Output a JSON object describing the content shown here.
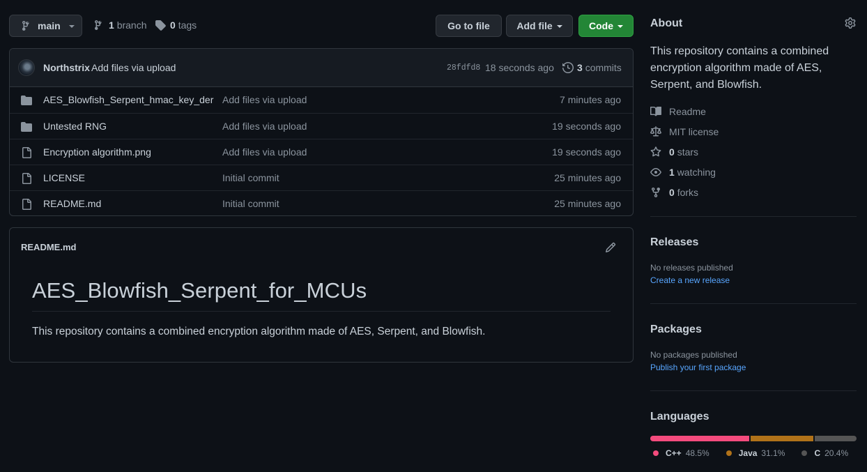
{
  "toolbar": {
    "branch_name": "main",
    "branch_count": "1",
    "branch_label": "branch",
    "tag_count": "0",
    "tag_label": "tags",
    "goto_file_label": "Go to file",
    "add_file_label": "Add file",
    "code_label": "Code"
  },
  "commit": {
    "author": "Northstrix",
    "message": "Add files via upload",
    "sha": "28fdfd8",
    "time": "18 seconds ago",
    "commits_count": "3",
    "commits_label": "commits"
  },
  "files": [
    {
      "type": "folder",
      "name": "AES_Blowfish_Serpent_hmac_key_der",
      "commit": "Add files via upload",
      "age": "7 minutes ago"
    },
    {
      "type": "folder",
      "name": "Untested RNG",
      "commit": "Add files via upload",
      "age": "19 seconds ago"
    },
    {
      "type": "file",
      "name": "Encryption algorithm.png",
      "commit": "Add files via upload",
      "age": "19 seconds ago"
    },
    {
      "type": "file",
      "name": "LICENSE",
      "commit": "Initial commit",
      "age": "25 minutes ago"
    },
    {
      "type": "file",
      "name": "README.md",
      "commit": "Initial commit",
      "age": "25 minutes ago"
    }
  ],
  "readme": {
    "filename": "README.md",
    "heading": "AES_Blowfish_Serpent_for_MCUs",
    "paragraph": "This repository contains a combined encryption algorithm made of AES, Serpent, and Blowfish."
  },
  "about": {
    "title": "About",
    "description": "This repository contains a combined encryption algorithm made of AES, Serpent, and Blowfish.",
    "readme_label": "Readme",
    "license_label": "MIT license",
    "stars_count": "0",
    "stars_label": "stars",
    "watching_count": "1",
    "watching_label": "watching",
    "forks_count": "0",
    "forks_label": "forks"
  },
  "releases": {
    "title": "Releases",
    "empty_text": "No releases published",
    "create_link": "Create a new release"
  },
  "packages": {
    "title": "Packages",
    "empty_text": "No packages published",
    "publish_link": "Publish your first package"
  },
  "languages": {
    "title": "Languages",
    "items": [
      {
        "name": "C++",
        "percent": "48.5%",
        "value": 48.5,
        "color": "#f34b7d"
      },
      {
        "name": "Java",
        "percent": "31.1%",
        "value": 31.1,
        "color": "#b07219"
      },
      {
        "name": "C",
        "percent": "20.4%",
        "value": 20.4,
        "color": "#555555"
      }
    ]
  },
  "colors": {
    "background": "#0d1117",
    "border": "#30363d",
    "text": "#c9d1d9",
    "muted": "#8b949e",
    "link": "#58a6ff",
    "code_button": "#238636"
  }
}
